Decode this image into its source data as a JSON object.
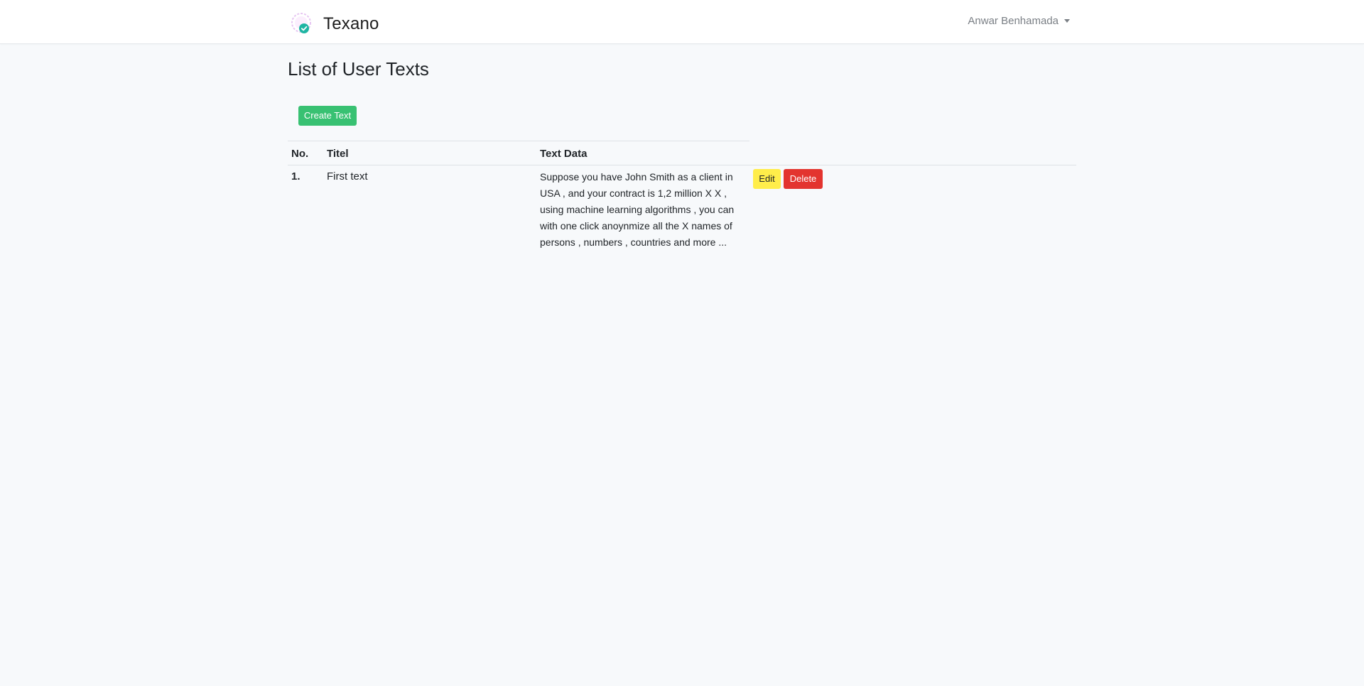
{
  "navbar": {
    "brand_name": "Texano",
    "user_name": "Anwar Benhamada"
  },
  "page": {
    "title": "List of User Texts",
    "create_button_label": "Create Text"
  },
  "table": {
    "headers": {
      "no": "No.",
      "title": "Titel",
      "text_data": "Text Data"
    },
    "rows": [
      {
        "no": "1.",
        "title": "First text",
        "text_data": "Suppose you have John Smith as a client in USA , and your contract is 1,2 million X X , using machine learning algorithms , you can with one click anoynmize all the X names of persons , numbers , countries and more ...",
        "edit_label": "Edit",
        "delete_label": "Delete"
      }
    ]
  },
  "colors": {
    "create_button": "#38c172",
    "edit_button": "#ffed4a",
    "delete_button": "#e3342f",
    "page_background": "#f7f9fb",
    "logo_check": "#1fb5a3",
    "logo_ring": "#e7c6f2"
  },
  "icons": {
    "brand_logo": "shield-check-logo",
    "user_menu_caret": "caret-down-icon"
  }
}
